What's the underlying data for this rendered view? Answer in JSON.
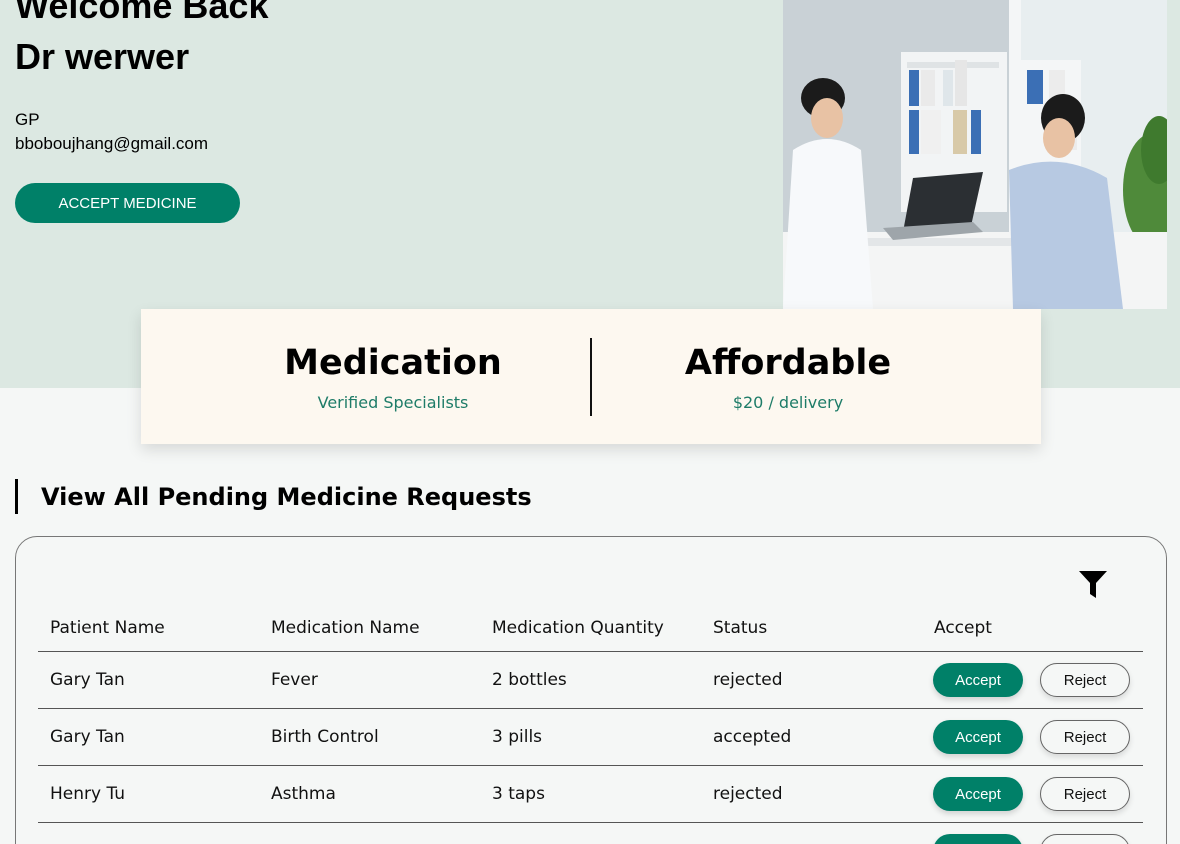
{
  "hero": {
    "welcome": "Welcome Back",
    "doctor_name": "Dr werwer",
    "role": "GP",
    "email": "bboboujhang@gmail.com",
    "accept_medicine_label": "ACCEPT MEDICINE",
    "photo_alt": "doctor consulting patient"
  },
  "stats": [
    {
      "title": "Medication",
      "subtitle": "Verified Specialists"
    },
    {
      "title": "Affordable",
      "subtitle": "$20 / delivery"
    }
  ],
  "section_title": "View All Pending Medicine Requests",
  "table": {
    "headers": [
      "Patient Name",
      "Medication Name",
      "Medication Quantity",
      "Status",
      "Accept"
    ],
    "rows": [
      {
        "patient": "Gary Tan",
        "medication": "Fever",
        "quantity": "2 bottles",
        "status": "rejected"
      },
      {
        "patient": "Gary Tan",
        "medication": "Birth Control",
        "quantity": "3 pills",
        "status": "accepted"
      },
      {
        "patient": "Henry Tu",
        "medication": "Asthma",
        "quantity": "3 taps",
        "status": "rejected"
      },
      {
        "patient": "",
        "medication": "",
        "quantity": "",
        "status": ""
      }
    ],
    "accept_label": "Accept",
    "reject_label": "Reject"
  },
  "colors": {
    "accent": "#008068",
    "hero_bg": "#dce8e2",
    "stats_bg": "#fdf8f0",
    "subtitle_text": "#1e7c68"
  },
  "icons": {
    "filter": "filter-icon"
  }
}
